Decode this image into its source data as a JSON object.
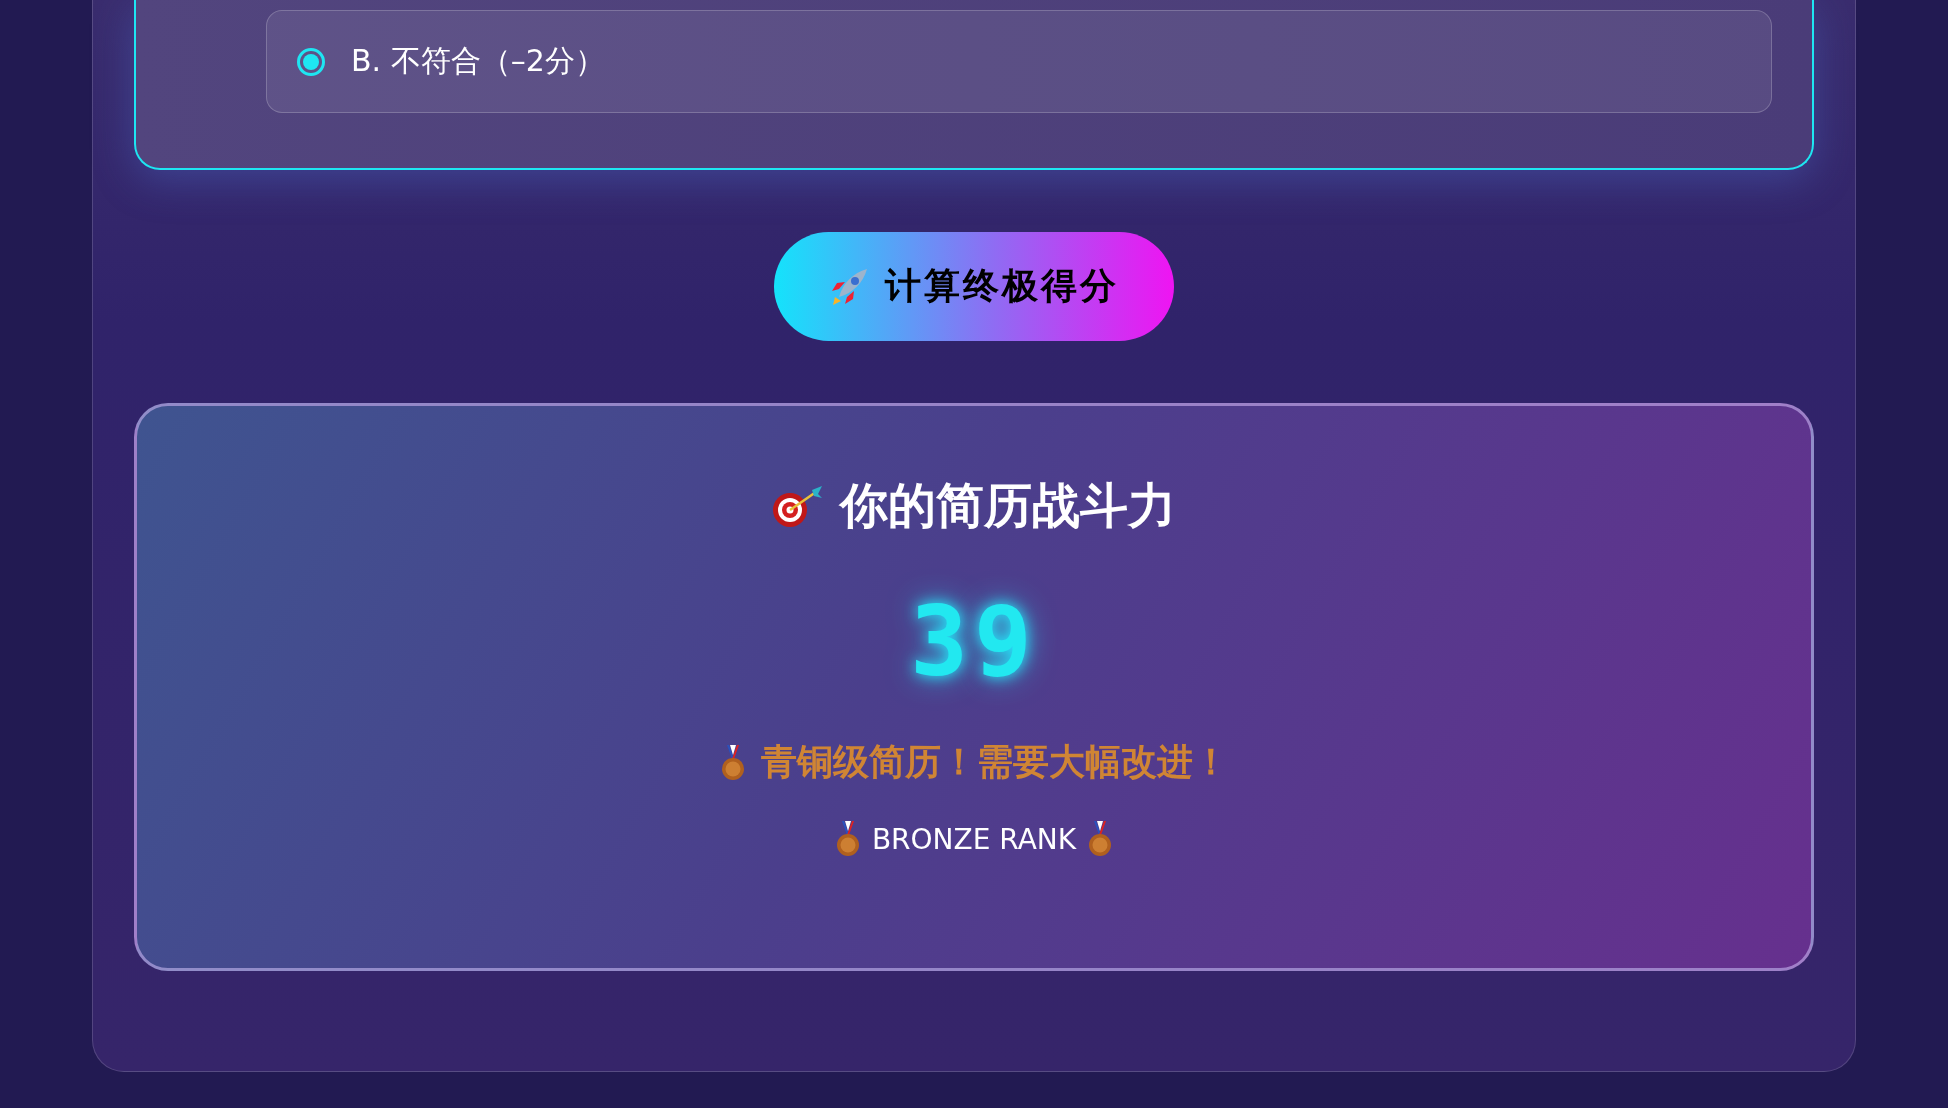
{
  "question": {
    "options": [
      {
        "label": "B. 不符合（–2分）",
        "selected": true
      }
    ]
  },
  "calculate_button": {
    "label": "计算终极得分"
  },
  "result": {
    "title": "你的简历战斗力",
    "score": "39",
    "verdict": "青铜级简历！需要大幅改进！",
    "rank": "BRONZE RANK"
  }
}
